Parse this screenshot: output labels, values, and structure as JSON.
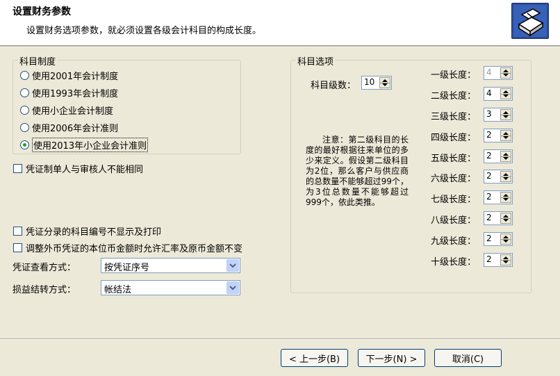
{
  "header": {
    "title": "设置财务参数",
    "subtitle": "设置财务选项参数，就必须设置各级会计科目的构成长度。",
    "icon": "wizard-box-icon"
  },
  "account_system": {
    "group_label": "科目制度",
    "options": [
      {
        "label": "使用2001年会计制度",
        "selected": false
      },
      {
        "label": "使用1993年会计制度",
        "selected": false
      },
      {
        "label": "使用小企业会计制度",
        "selected": false
      },
      {
        "label": "使用2006年会计准则",
        "selected": false
      },
      {
        "label": "使用2013年小企业会计准则",
        "selected": true
      }
    ]
  },
  "checks": {
    "maker_reviewer": "凭证制单人与审核人不能相同",
    "hide_account_code": "凭证分录的科目编号不显示及打印",
    "allow_rate_adjust": "调整外币凭证的本位币金额时允许汇率及原币金额不变"
  },
  "voucher_view": {
    "label": "凭证查看方式：",
    "value": "按凭证序号"
  },
  "pl_transfer": {
    "label": "损益结转方式：",
    "value": "帐结法"
  },
  "account_options": {
    "group_label": "科目选项",
    "levels_label": "科目级数：",
    "levels_value": "10",
    "note": "注意：第二级科目的长度的最好根据往来单位的多少来定义。假设第二级科目为2位，那么客户与供应商的总数量不能够超过99个，为3位总数量不能够超过999个，依此类推。",
    "lengths": [
      {
        "label": "一级长度：",
        "value": "4",
        "disabled": true
      },
      {
        "label": "二级长度：",
        "value": "4",
        "disabled": false
      },
      {
        "label": "三级长度：",
        "value": "3",
        "disabled": false
      },
      {
        "label": "四级长度：",
        "value": "2",
        "disabled": false
      },
      {
        "label": "五级长度：",
        "value": "2",
        "disabled": false
      },
      {
        "label": "六级长度：",
        "value": "2",
        "disabled": false
      },
      {
        "label": "七级长度：",
        "value": "2",
        "disabled": false
      },
      {
        "label": "八级长度：",
        "value": "2",
        "disabled": false
      },
      {
        "label": "九级长度：",
        "value": "2",
        "disabled": false
      },
      {
        "label": "十级长度：",
        "value": "2",
        "disabled": false
      }
    ]
  },
  "footer": {
    "prev": "< 上一步(B)",
    "next": "下一步(N) >",
    "cancel": "取消(C)"
  }
}
